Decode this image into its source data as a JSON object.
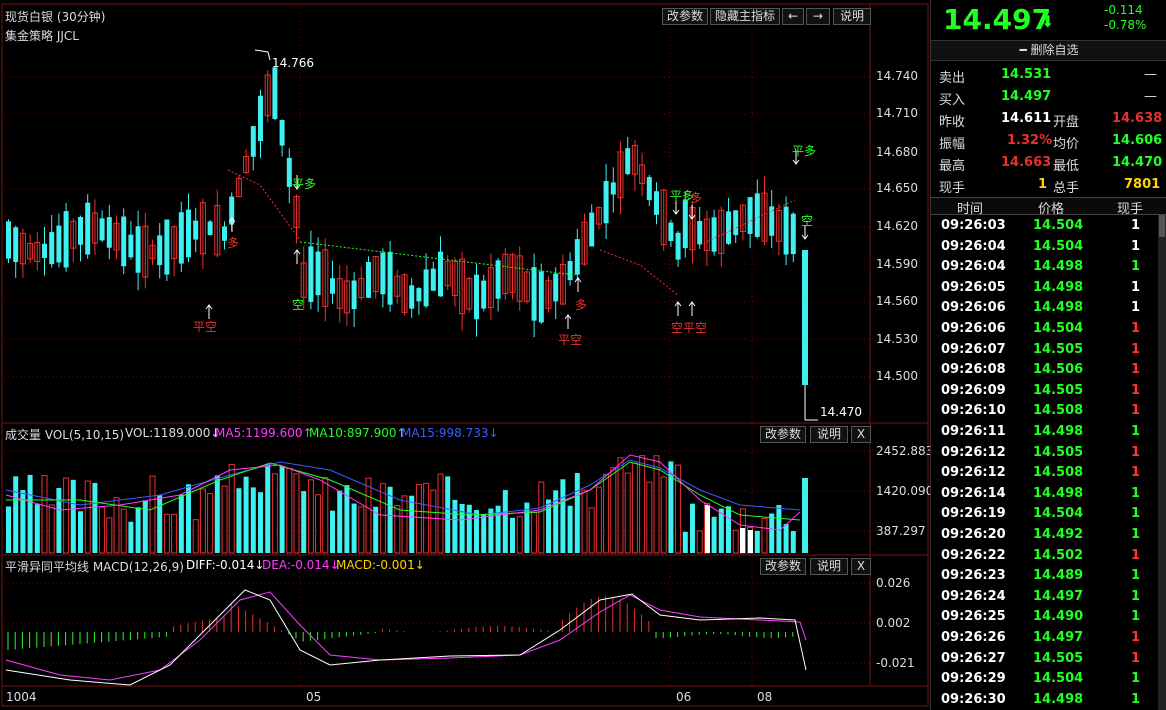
{
  "window": {
    "title": "现货白银 (30分钟)",
    "strategy": "集金策略 JJCL",
    "buttons": [
      "改参数",
      "隐藏主指标",
      "←",
      "→",
      "说明"
    ],
    "price_labels": [
      "14.740",
      "14.710",
      "14.680",
      "14.650",
      "14.620",
      "14.590",
      "14.560",
      "14.530",
      "14.500"
    ],
    "high_mark": "14.766",
    "low_mark": "14.470",
    "signals": [
      "平空",
      "多",
      "平多",
      "空",
      "平空",
      "多",
      "平多",
      "多",
      "空平空",
      "平多",
      "空"
    ]
  },
  "volume_panel": {
    "title": "成交量 VOL(5,10,15)",
    "vol": "VOL:1189.000↓",
    "ma5": "MA5:1199.600↑",
    "ma10": "MA10:897.900↑",
    "ma15": "MA15:998.733↓",
    "buttons": [
      "改参数",
      "说明",
      "X"
    ],
    "axis": [
      "2452.883",
      "1420.090",
      "387.297"
    ]
  },
  "macd_panel": {
    "title": "平滑异同平均线 MACD(12,26,9)",
    "diff": "DIFF:-0.014↓",
    "dea": "DEA:-0.014↓",
    "macd": "MACD:-0.001↓",
    "buttons": [
      "改参数",
      "说明",
      "X"
    ],
    "axis": [
      "0.026",
      "0.002",
      "-0.021"
    ]
  },
  "date_axis": [
    "1004",
    "05",
    "06",
    "08"
  ],
  "quote": {
    "price": "14.497",
    "arrow": "⬇",
    "change": "-0.114",
    "change_pct": "-0.78%",
    "remove_watch": "━ 删除自选",
    "sell_label": "卖出",
    "sell": "14.531",
    "sell_vol": "—",
    "buy_label": "买入",
    "buy": "14.497",
    "buy_vol": "—",
    "prev_close_label": "昨收",
    "prev_close": "14.611",
    "open_label": "开盘",
    "open": "14.638",
    "amp_label": "振幅",
    "amp": "1.32%",
    "avg_label": "均价",
    "avg": "14.606",
    "high_label": "最高",
    "high": "14.663",
    "low_label": "最低",
    "low": "14.470",
    "cur_hand_label": "现手",
    "cur_hand": "1",
    "total_hand_label": "总手",
    "total_hand": "7801"
  },
  "ticks_header": [
    "时间",
    "价格",
    "现手"
  ],
  "ticks": [
    {
      "time": "09:26:03",
      "price": "14.504",
      "vol": "1"
    },
    {
      "time": "09:26:04",
      "price": "14.504",
      "vol": "1"
    },
    {
      "time": "09:26:04",
      "price": "14.498",
      "vol": "1"
    },
    {
      "time": "09:26:05",
      "price": "14.498",
      "vol": "1"
    },
    {
      "time": "09:26:06",
      "price": "14.498",
      "vol": "1"
    },
    {
      "time": "09:26:06",
      "price": "14.504",
      "vol": "1"
    },
    {
      "time": "09:26:07",
      "price": "14.505",
      "vol": "1"
    },
    {
      "time": "09:26:08",
      "price": "14.506",
      "vol": "1"
    },
    {
      "time": "09:26:09",
      "price": "14.505",
      "vol": "1"
    },
    {
      "time": "09:26:10",
      "price": "14.508",
      "vol": "1"
    },
    {
      "time": "09:26:11",
      "price": "14.498",
      "vol": "1"
    },
    {
      "time": "09:26:12",
      "price": "14.505",
      "vol": "1"
    },
    {
      "time": "09:26:12",
      "price": "14.508",
      "vol": "1"
    },
    {
      "time": "09:26:14",
      "price": "14.498",
      "vol": "1"
    },
    {
      "time": "09:26:19",
      "price": "14.504",
      "vol": "1"
    },
    {
      "time": "09:26:20",
      "price": "14.492",
      "vol": "1"
    },
    {
      "time": "09:26:22",
      "price": "14.502",
      "vol": "1"
    },
    {
      "time": "09:26:23",
      "price": "14.489",
      "vol": "1"
    },
    {
      "time": "09:26:24",
      "price": "14.497",
      "vol": "1"
    },
    {
      "time": "09:26:25",
      "price": "14.490",
      "vol": "1"
    },
    {
      "time": "09:26:26",
      "price": "14.497",
      "vol": "1"
    },
    {
      "time": "09:26:27",
      "price": "14.505",
      "vol": "1"
    },
    {
      "time": "09:26:29",
      "price": "14.504",
      "vol": "1"
    },
    {
      "time": "09:26:30",
      "price": "14.498",
      "vol": "1"
    }
  ],
  "tick_vol_colors": [
    "#fff",
    "#fff",
    "#2f2",
    "#fff",
    "#fff",
    "#f33",
    "#f33",
    "#f33",
    "#f33",
    "#f33",
    "#2f2",
    "#f33",
    "#f33",
    "#2f2",
    "#2f2",
    "#2f2",
    "#f33",
    "#2f2",
    "#2f2",
    "#2f2",
    "#f33",
    "#f33",
    "#2f2",
    "#2f2"
  ],
  "colors": {
    "up": "#e8312f",
    "down": "#3ff0f0",
    "green": "#22ff22",
    "yellow": "#ffd400"
  }
}
